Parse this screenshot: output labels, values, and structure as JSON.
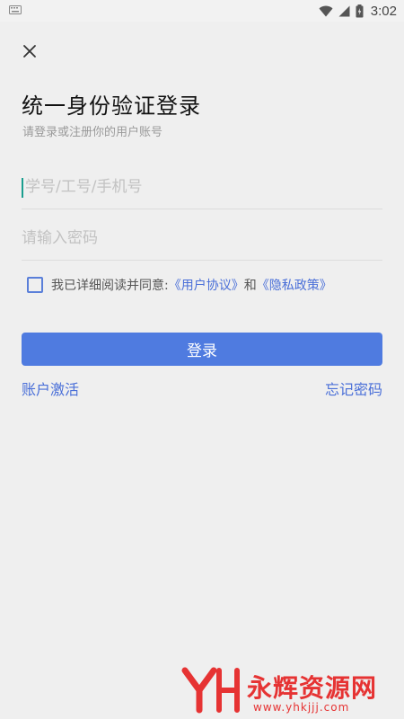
{
  "status_bar": {
    "time": "3:02"
  },
  "header": {
    "title": "统一身份验证登录",
    "subtitle": "请登录或注册你的用户账号"
  },
  "form": {
    "username_placeholder": "学号/工号/手机号",
    "password_placeholder": "请输入密码",
    "agreement_prefix": "我已详细阅读并同意:",
    "user_agreement": "《用户协议》",
    "agreement_and": "和",
    "privacy_policy": "《隐私政策》",
    "login_label": "登录"
  },
  "footer_links": {
    "activate": "账户激活",
    "forgot": "忘记密码"
  },
  "watermark": {
    "name": "永辉资源网",
    "url": "www.yhkjjj.com"
  },
  "colors": {
    "primary": "#4f7be0",
    "link": "#4a6fd8",
    "background": "#efefef",
    "watermark": "#e63333"
  }
}
